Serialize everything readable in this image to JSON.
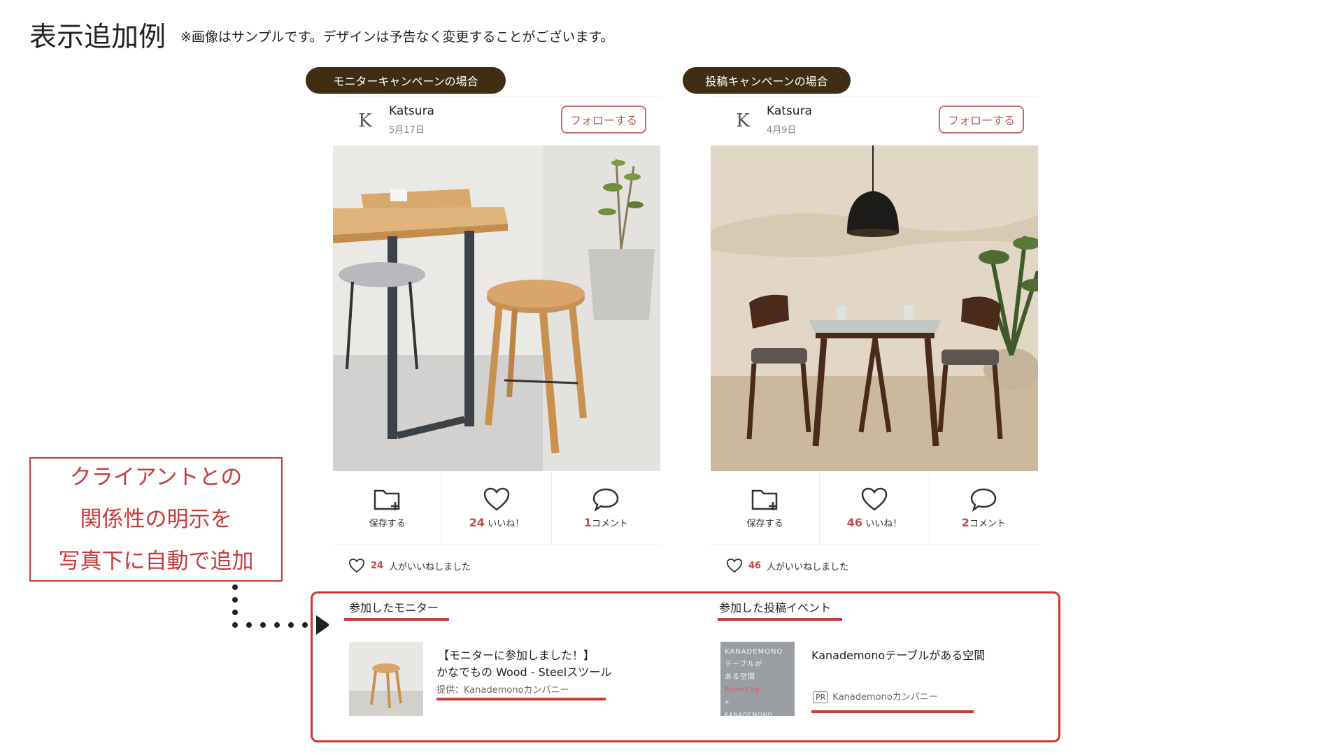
{
  "header": {
    "title": "表示追加例",
    "note": "※画像はサンプルです。デザインは予告なく変更することがございます。"
  },
  "cards": [
    {
      "badge": "モニターキャンペーンの場合",
      "user": "Katsura",
      "date": "5月17日",
      "logo": "K",
      "follow_label": "フォローする",
      "save_label": "保存する",
      "like_count": "24",
      "like_label": "いいね！",
      "comment_count": "1",
      "comment_label": "コメント",
      "likes_line_count": "24",
      "likes_line_text": "人がいいねしました"
    },
    {
      "badge": "投稿キャンペーンの場合",
      "user": "Katsura",
      "date": "4月9日",
      "logo": "K",
      "follow_label": "フォローする",
      "save_label": "保存する",
      "like_count": "46",
      "like_label": "いいね！",
      "comment_count": "2",
      "comment_label": "コメント",
      "likes_line_count": "46",
      "likes_line_text": "人がいいねしました"
    }
  ],
  "callout": {
    "lines": [
      "クライアントとの",
      "関係性の明示を",
      "写真下に自動で追加"
    ]
  },
  "monitor_section": {
    "title": "参加したモニター",
    "entry_line1": "【モニターに参加しました！】",
    "entry_line2": "かなでもの Wood - Steelスツール",
    "provider": "提供：Kanademonoカンパニー"
  },
  "event_section": {
    "title": "参加した投稿イベント",
    "entry_title": "Kanademonoテーブルがある空間",
    "pr_label": "PR",
    "provider": "Kanademonoカンパニー",
    "thumb_text": [
      "KANADEMONO",
      "テーブルが",
      "ある空間",
      "RoomClip",
      "×",
      "KANADEMONO"
    ]
  },
  "colors": {
    "accent_red": "#c83b3b",
    "badge_brown": "#3f2e14",
    "count_red": "#c24a4a"
  },
  "icons": [
    "folder-plus-icon",
    "heart-icon",
    "comment-icon",
    "play-triangle-icon"
  ]
}
